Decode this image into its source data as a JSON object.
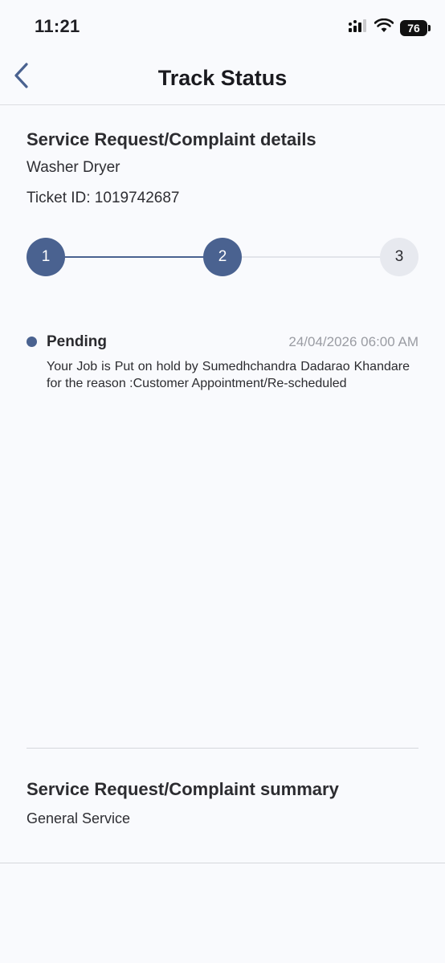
{
  "status_bar": {
    "time": "11:21",
    "battery": "76",
    "signal_icon": "signal-bars-icon",
    "wifi_icon": "wifi-icon"
  },
  "header": {
    "back_icon": "chevron-left-icon",
    "title": "Track Status"
  },
  "details": {
    "heading": "Service Request/Complaint details",
    "product": "Washer Dryer",
    "ticket": "Ticket ID: 1019742687"
  },
  "stepper": {
    "steps": [
      {
        "label": "1",
        "state": "completed"
      },
      {
        "label": "2",
        "state": "completed"
      },
      {
        "label": "3",
        "state": "pending"
      }
    ],
    "colors": {
      "active": "#4a6290",
      "inactive": "#e7e9ef"
    }
  },
  "timeline": {
    "entries": [
      {
        "status": "Pending",
        "date": "24/04/2026 06:00 AM",
        "description": "Your Job is Put on hold by Sumedhchandra Dadarao Khandare for the reason :Customer Appointment/Re-scheduled"
      }
    ]
  },
  "summary": {
    "heading": "Service Request/Complaint summary",
    "value": "General Service"
  }
}
